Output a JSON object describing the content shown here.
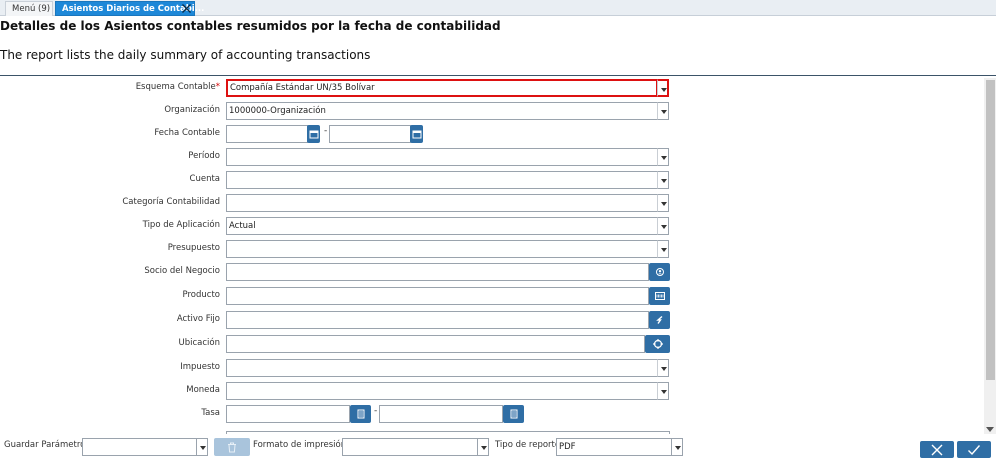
{
  "tabs": {
    "menu_label": "Menú (9)",
    "active_label": "Asientos Diarios de Contabi..."
  },
  "report": {
    "title": "Detalles de los Asientos contables resumidos por la fecha de contabilidad",
    "description": "The report lists the daily summary of accounting transactions"
  },
  "form": {
    "esquema_contable": {
      "label": "Esquema Contable",
      "required_mark": "*",
      "value": "Compañía Estándar UN/35 Bolívar"
    },
    "organizacion": {
      "label": "Organización",
      "value": "1000000-Organización"
    },
    "fecha_contable": {
      "label": "Fecha Contable",
      "from": "",
      "to": "",
      "separator": "-"
    },
    "periodo": {
      "label": "Período",
      "value": ""
    },
    "cuenta": {
      "label": "Cuenta",
      "value": ""
    },
    "categoria_contable": {
      "label": "Categoría Contabilidad",
      "value": ""
    },
    "tipo_aplicacion": {
      "label": "Tipo de Aplicación",
      "value": "Actual"
    },
    "presupuesto": {
      "label": "Presupuesto",
      "value": ""
    },
    "socio_negocio": {
      "label": "Socio del Negocio",
      "value": ""
    },
    "producto": {
      "label": "Producto",
      "value": ""
    },
    "activo_fijo": {
      "label": "Activo Fijo",
      "value": ""
    },
    "ubicacion": {
      "label": "Ubicación",
      "value": ""
    },
    "impuesto": {
      "label": "Impuesto",
      "value": ""
    },
    "moneda": {
      "label": "Moneda",
      "value": ""
    },
    "tasa": {
      "label": "Tasa",
      "from": "",
      "to": "",
      "separator": "-"
    }
  },
  "bottom": {
    "guardar_parametro": {
      "label": "Guardar Parámetro",
      "value": ""
    },
    "formato_impresion": {
      "label": "Formato de impresión",
      "value": ""
    },
    "tipo_reporte": {
      "label": "Tipo de reporte",
      "value": "PDF"
    }
  },
  "colors": {
    "accent": "#1e88d8",
    "button": "#2f6ea5",
    "required_border": "#d11111"
  },
  "icons": {
    "calendar": "calendar-icon",
    "calculator": "calculator-icon",
    "business_partner": "business-partner-icon",
    "product": "product-icon",
    "asset": "asset-icon",
    "location": "location-icon",
    "trash": "trash-icon",
    "cancel": "close-icon",
    "ok": "check-icon"
  }
}
